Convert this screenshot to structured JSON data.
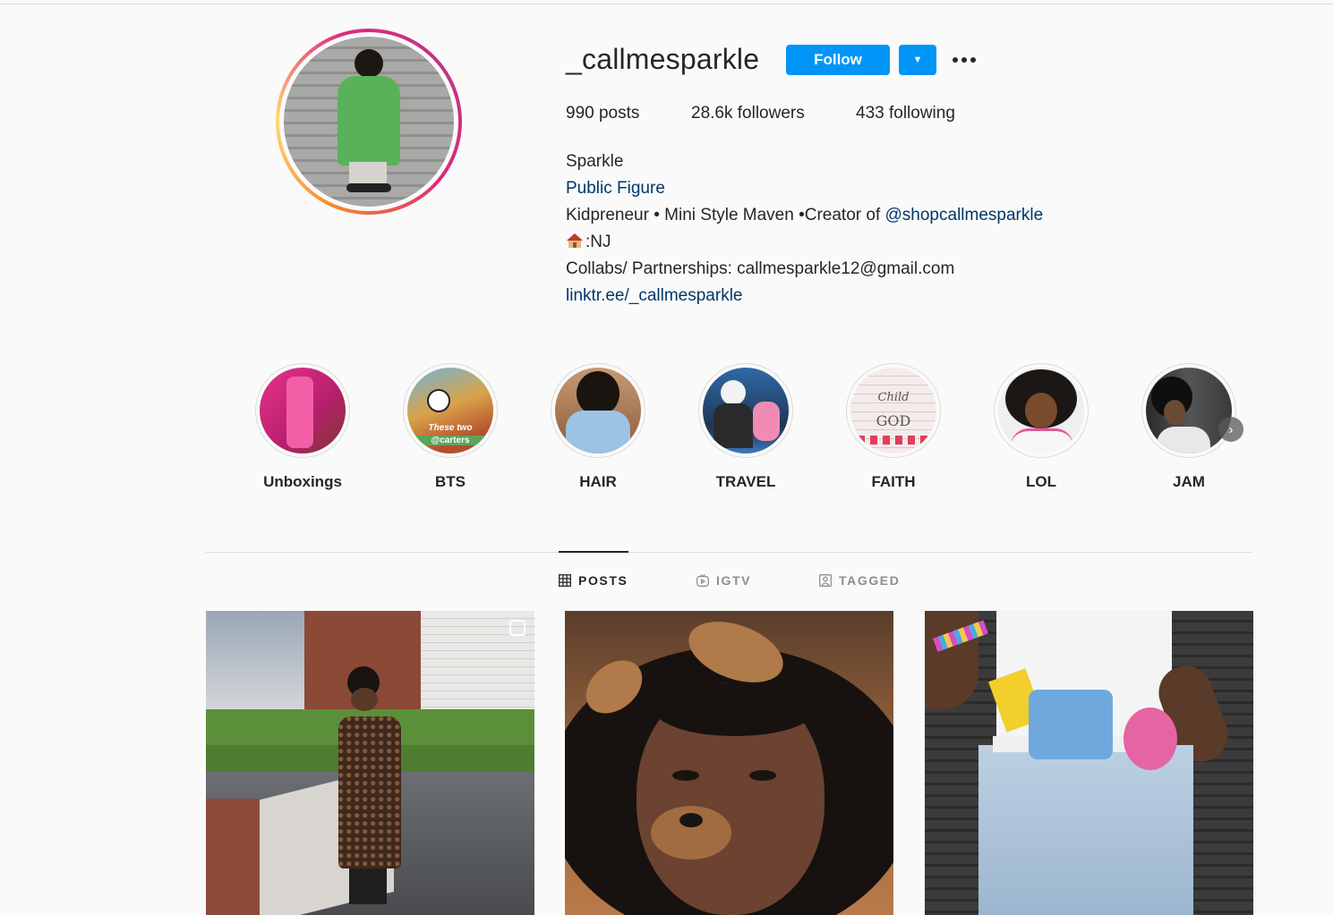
{
  "profile": {
    "username": "_callmesparkle",
    "follow_label": "Follow",
    "stats": {
      "posts": "990 posts",
      "followers": "28.6k followers",
      "following": "433 following"
    },
    "bio": {
      "name": "Sparkle",
      "category": "Public Figure",
      "line1_text": "Kidpreneur • Mini Style Maven •Creator of ",
      "line1_mention": "@shopcallmesparkle",
      "location": ":NJ",
      "contact": "Collabs/ Partnerships: callmesparkle12@gmail.com",
      "website": "linktr.ee/_callmesparkle"
    }
  },
  "highlights": [
    {
      "label": "Unboxings"
    },
    {
      "label": "BTS",
      "overlay_1": "These two",
      "overlay_2": "@carters"
    },
    {
      "label": "HAIR"
    },
    {
      "label": "TRAVEL"
    },
    {
      "label": "FAITH",
      "overlay_1": "Child",
      "overlay_2": "GOD"
    },
    {
      "label": "LOL"
    },
    {
      "label": "JAM"
    }
  ],
  "tabs": [
    {
      "label": "POSTS",
      "icon": "grid-icon",
      "active": true
    },
    {
      "label": "IGTV",
      "icon": "igtv-icon",
      "active": false
    },
    {
      "label": "TAGGED",
      "icon": "tagged-icon",
      "active": false
    }
  ],
  "colors": {
    "accent": "#0095f6",
    "link": "#00376b",
    "background": "#fafafa"
  }
}
